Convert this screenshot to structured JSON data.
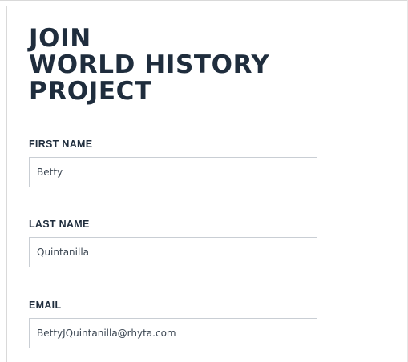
{
  "form": {
    "title_lines": [
      "JOIN",
      "WORLD HISTORY",
      "PROJECT"
    ],
    "fields": [
      {
        "label": "FIRST NAME",
        "value": "Betty"
      },
      {
        "label": "LAST NAME",
        "value": "Quintanilla"
      },
      {
        "label": "EMAIL",
        "value": "BettyJQuintanilla@rhyta.com"
      }
    ]
  }
}
